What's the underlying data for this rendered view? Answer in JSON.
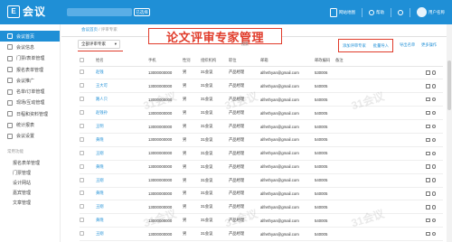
{
  "app": {
    "logo_mark": "E",
    "logo_text": "会议",
    "org_button": "已选择"
  },
  "header": {
    "items": [
      {
        "label": "网站地图",
        "icon": "phone-icon"
      },
      {
        "label": "帮助",
        "icon": "help-icon"
      },
      {
        "label": "",
        "icon": "message-icon"
      },
      {
        "label": "用户名称",
        "icon": "avatar"
      }
    ]
  },
  "sidebar": {
    "items": [
      {
        "label": "会议首页",
        "active": true
      },
      {
        "label": "会议信息",
        "active": false
      },
      {
        "label": "门票/表单管理",
        "active": false
      },
      {
        "label": "报名表单管理",
        "active": false
      },
      {
        "label": "会议推广",
        "active": false
      },
      {
        "label": "名单/订单管理",
        "active": false
      },
      {
        "label": "现场/互动管理",
        "active": false
      },
      {
        "label": "日程和资料管理",
        "active": false
      },
      {
        "label": "统计报表",
        "active": false
      },
      {
        "label": "会议设置",
        "active": false
      }
    ],
    "section_title": "常用功能",
    "sub_items": [
      "报名表单管理",
      "门票管理",
      "设计网站",
      "嘉宾管理",
      "文章管理"
    ]
  },
  "main": {
    "breadcrumb_home": "会议首页",
    "breadcrumb_sep": " / ",
    "breadcrumb_current": "评审专家",
    "title_overlay": "论文评审专家管理",
    "filter_value": "全部评审专家",
    "search_label": "搜索",
    "actions": {
      "add": "添加评审专家",
      "batch": "批量导入",
      "export": "导出名单",
      "more": "更多操作"
    }
  },
  "table": {
    "columns": [
      "姓名",
      "手机",
      "性别",
      "组织机构",
      "职位",
      "邮箱",
      "邮政编码",
      "备注"
    ],
    "rows": [
      {
        "name": "赵钱",
        "phone": "13000000000",
        "gender": "男",
        "org": "31会议",
        "title": "产品经理",
        "email": "alfrethyan@gmail.com",
        "zip": "530006"
      },
      {
        "name": "王大可",
        "phone": "13000000000",
        "gender": "男",
        "org": "31会议",
        "title": "产品经理",
        "email": "alfrethyan@gmail.com",
        "zip": "540005"
      },
      {
        "name": "路人只",
        "phone": "13000000000",
        "gender": "男",
        "org": "31会议",
        "title": "产品经理",
        "email": "alfrethyan@gmail.com",
        "zip": "540005"
      },
      {
        "name": "赵钱孙",
        "phone": "13000000000",
        "gender": "男",
        "org": "31会议",
        "title": "产品经理",
        "email": "alfrethyan@gmail.com",
        "zip": "540005"
      },
      {
        "name": "王明",
        "phone": "13000000000",
        "gender": "男",
        "org": "31会议",
        "title": "产品经理",
        "email": "alfrethyan@gmail.com",
        "zip": "540005"
      },
      {
        "name": "黄晓",
        "phone": "13000000000",
        "gender": "男",
        "org": "31会议",
        "title": "产品经理",
        "email": "alfrethyan@gmail.com",
        "zip": "540005"
      },
      {
        "name": "王刚",
        "phone": "13000000000",
        "gender": "男",
        "org": "31会议",
        "title": "产品经理",
        "email": "alfrethyan@gmail.com",
        "zip": "540005"
      },
      {
        "name": "黄晓",
        "phone": "13000000000",
        "gender": "男",
        "org": "31会议",
        "title": "产品经理",
        "email": "alfrethyan@gmail.com",
        "zip": "540005"
      },
      {
        "name": "王刚",
        "phone": "13000000000",
        "gender": "男",
        "org": "31会议",
        "title": "产品经理",
        "email": "alfrethyan@gmail.com",
        "zip": "540005"
      },
      {
        "name": "黄晓",
        "phone": "13000000000",
        "gender": "男",
        "org": "31会议",
        "title": "产品经理",
        "email": "alfrethyan@gmail.com",
        "zip": "540005"
      },
      {
        "name": "王刚",
        "phone": "13000000000",
        "gender": "男",
        "org": "31会议",
        "title": "产品经理",
        "email": "alfrethyan@gmail.com",
        "zip": "540005"
      },
      {
        "name": "黄晓",
        "phone": "13000000000",
        "gender": "男",
        "org": "31会议",
        "title": "产品经理",
        "email": "alfrethyan@gmail.com",
        "zip": "540005"
      },
      {
        "name": "王刚",
        "phone": "13000000000",
        "gender": "男",
        "org": "31会议",
        "title": "产品经理",
        "email": "alfrethyan@gmail.com",
        "zip": "540005"
      }
    ]
  },
  "watermark": "31会议",
  "colors": {
    "primary": "#1f8fd6",
    "highlight": "#e03b2a"
  }
}
